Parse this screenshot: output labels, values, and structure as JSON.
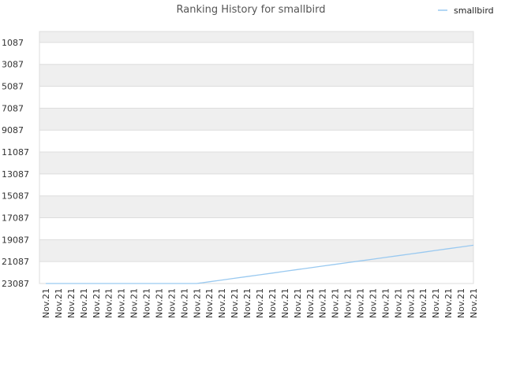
{
  "chart_data": {
    "type": "line",
    "title": "Ranking History for smallbird",
    "xlabel": "",
    "ylabel": "",
    "y_inverted": true,
    "ylim": [
      23087,
      87
    ],
    "yticks": [
      1087,
      3087,
      5087,
      7087,
      9087,
      11087,
      13087,
      15087,
      17087,
      19087,
      21087,
      23087
    ],
    "grid": "horizontal alternating bands",
    "legend": {
      "position": "top-right"
    },
    "x": [
      "Nov.21",
      "Nov.21",
      "Nov.21",
      "Nov.21",
      "Nov.21",
      "Nov.21",
      "Nov.21",
      "Nov.21",
      "Nov.21",
      "Nov.21",
      "Nov.21",
      "Nov.21",
      "Nov.21",
      "Nov.21",
      "Nov.21",
      "Nov.21",
      "Nov.21",
      "Nov.21",
      "Nov.21",
      "Nov.21",
      "Nov.21",
      "Nov.21",
      "Nov.21",
      "Nov.21",
      "Nov.21",
      "Nov.21",
      "Nov.21",
      "Nov.21",
      "Nov.21",
      "Nov.21",
      "Nov.21",
      "Nov.21",
      "Nov.21",
      "Nov.21",
      "Nov.21"
    ],
    "series": [
      {
        "name": "smallbird",
        "color": "#99c9f0",
        "values": [
          23087,
          23087,
          23087,
          23087,
          23087,
          23087,
          23087,
          23087,
          23087,
          23087,
          23087,
          23087,
          23087,
          22928,
          22769,
          22611,
          22452,
          22293,
          22135,
          21976,
          21817,
          21658,
          21500,
          21341,
          21182,
          21023,
          20865,
          20706,
          20547,
          20389,
          20230,
          20071,
          19912,
          19754,
          19595
        ]
      }
    ]
  }
}
